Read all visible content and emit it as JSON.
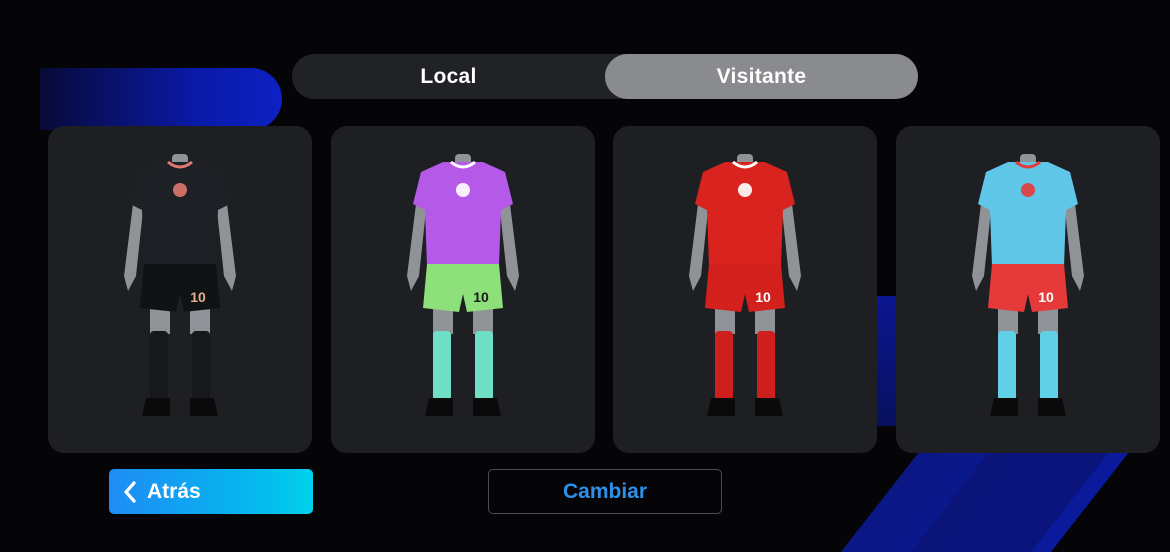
{
  "tabs": [
    {
      "label": "Local",
      "active": false
    },
    {
      "label": "Visitante",
      "active": true
    }
  ],
  "kits": [
    {
      "name": "kit-black",
      "shirt": "#1d2024",
      "shorts": "#101214",
      "socks": "#16181b",
      "number": "10",
      "accent": "#e0796f",
      "number_color": "#e8b090"
    },
    {
      "name": "kit-tie-dye",
      "shirt": "#b55ae8",
      "shorts": "#8ee07a",
      "socks": "#6fe0c8",
      "number": "10",
      "accent": "#ffffff",
      "number_color": "#1a1a1a"
    },
    {
      "name": "kit-red",
      "shirt": "#d9231f",
      "shorts": "#d3201d",
      "socks": "#cf1f1c",
      "number": "10",
      "accent": "#ffffff",
      "number_color": "#ffffff"
    },
    {
      "name": "kit-pattern",
      "shirt": "#5fc6e8",
      "shorts": "#e63a3a",
      "socks": "#5fd0e6",
      "number": "10",
      "accent": "#e63a3a",
      "number_color": "#ffffff"
    }
  ],
  "buttons": {
    "back_label": "Atrás",
    "change_label": "Cambiar"
  },
  "colors": {
    "accent": "#0cb2ee",
    "change_text": "#2f90ea",
    "tab_active": "#8a8b8f"
  },
  "icons": {
    "back": "chevron-left-icon"
  }
}
